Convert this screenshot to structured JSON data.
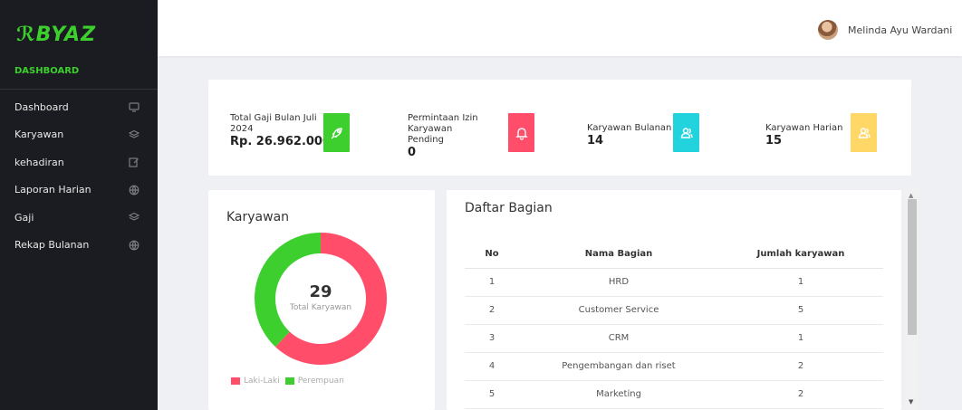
{
  "brand": {
    "logo": "ℛBYAZ"
  },
  "sidebar": {
    "section": "DASHBOARD",
    "items": [
      {
        "label": "Dashboard",
        "icon": "monitor-icon"
      },
      {
        "label": "Karyawan",
        "icon": "layers-icon"
      },
      {
        "label": "kehadiran",
        "icon": "edit-icon"
      },
      {
        "label": "Laporan Harian",
        "icon": "globe-icon"
      },
      {
        "label": "Gaji",
        "icon": "layers-icon"
      },
      {
        "label": "Rekap Bulanan",
        "icon": "globe-icon"
      }
    ]
  },
  "header": {
    "user_name": "Melinda Ayu Wardani",
    "chevron": "﹀"
  },
  "stats": [
    {
      "label": "Total Gaji Bulan Juli 2024",
      "value": "Rp. 26.962.000",
      "color": "#3ccf2e",
      "icon": "rocket-icon"
    },
    {
      "label": "Permintaan Izin Karyawan Pending",
      "value": "0",
      "color": "#ff4d6a",
      "icon": "bell-icon"
    },
    {
      "label": "Karyawan Bulanan",
      "value": "14",
      "color": "#22d3de",
      "icon": "users-icon"
    },
    {
      "label": "Karyawan Harian",
      "value": "15",
      "color": "#ffd766",
      "icon": "users-icon"
    }
  ],
  "employees": {
    "title": "Karyawan",
    "total": "29",
    "total_label": "Total Karyawan",
    "segments": [
      {
        "name": "Laki-Laki",
        "fraction": 0.62,
        "color": "#ff4d6a"
      },
      {
        "name": "Perempuan",
        "fraction": 0.38,
        "color": "#3ccf2e"
      }
    ]
  },
  "departments": {
    "title": "Daftar Bagian",
    "columns": [
      "No",
      "Nama Bagian",
      "Jumlah karyawan"
    ],
    "rows": [
      [
        "1",
        "HRD",
        "1"
      ],
      [
        "2",
        "Customer Service",
        "5"
      ],
      [
        "3",
        "CRM",
        "1"
      ],
      [
        "4",
        "Pengembangan dan riset",
        "2"
      ],
      [
        "5",
        "Marketing",
        "2"
      ]
    ]
  },
  "scrollbar": {
    "up": "▲",
    "down": "▼"
  }
}
